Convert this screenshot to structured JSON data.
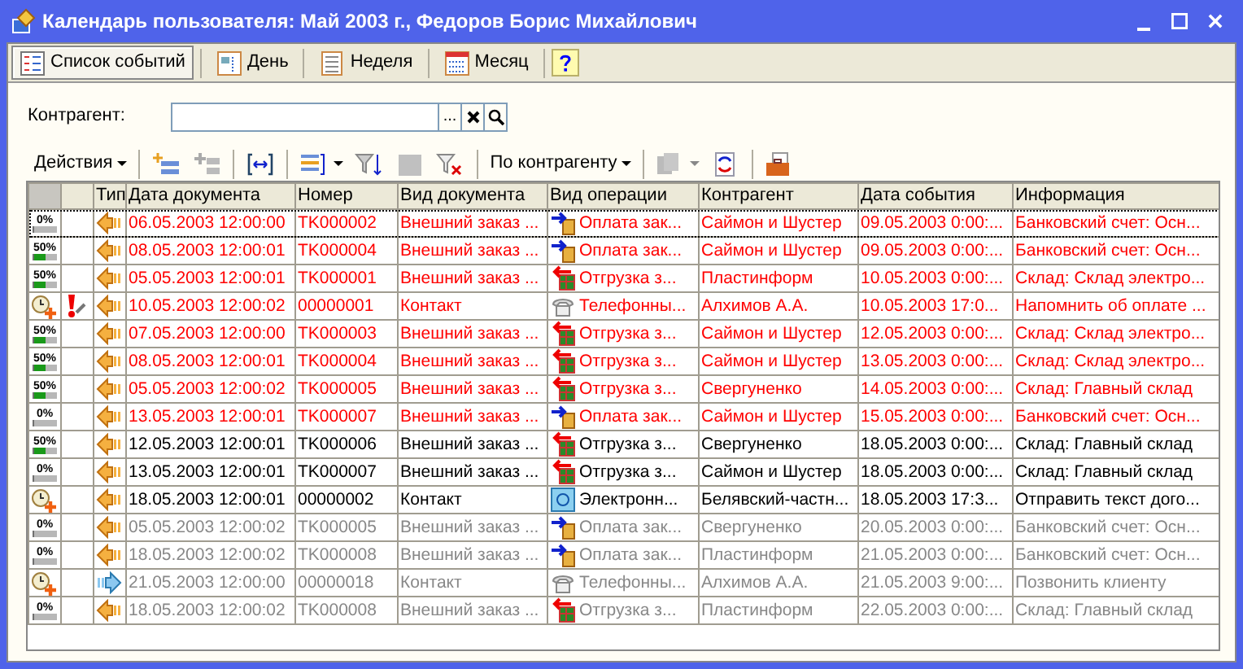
{
  "window": {
    "title": "Календарь пользователя: Май 2003 г., Федоров Борис Михайлович"
  },
  "view_tabs": [
    {
      "label": "Список событий",
      "kind": "list",
      "selected": true
    },
    {
      "label": "День",
      "kind": "day",
      "selected": false
    },
    {
      "label": "Неделя",
      "kind": "week",
      "selected": false
    },
    {
      "label": "Месяц",
      "kind": "month",
      "selected": false
    }
  ],
  "filter": {
    "label": "Контрагент:",
    "select_button": "..."
  },
  "actions_menu": "Действия",
  "group_menu": "По контрагенту",
  "table": {
    "columns": [
      "Тип",
      "Дата документа",
      "Номер",
      "Вид документа",
      "Вид операции",
      "Контрагент",
      "Дата события",
      "Информация"
    ],
    "rows": [
      {
        "selected": true,
        "overdue": true,
        "inactive": false,
        "status": {
          "kind": "task",
          "label": "0%",
          "level": 0
        },
        "important": false,
        "incoming": false,
        "doc_date": "06.05.2003 12:00:00",
        "number": "TK000002",
        "doc_type": "Внешний заказ ...",
        "operation": {
          "kind": "payment",
          "text": "Оплата зак..."
        },
        "counterparty": "Саймон и Шустер",
        "event_date": "09.05.2003 0:00:...",
        "info": "Банковский счет: Осн..."
      },
      {
        "selected": false,
        "overdue": true,
        "inactive": false,
        "status": {
          "kind": "task",
          "label": "50%",
          "level": 0.5
        },
        "important": false,
        "incoming": false,
        "doc_date": "08.05.2003 12:00:01",
        "number": "TK000004",
        "doc_type": "Внешний заказ ...",
        "operation": {
          "kind": "payment",
          "text": "Оплата зак..."
        },
        "counterparty": "Саймон и Шустер",
        "event_date": "09.05.2003 0:00:...",
        "info": "Банковский счет: Осн..."
      },
      {
        "selected": false,
        "overdue": true,
        "inactive": false,
        "status": {
          "kind": "task",
          "label": "50%",
          "level": 0.5
        },
        "important": false,
        "incoming": false,
        "doc_date": "05.05.2003 12:00:01",
        "number": "TK000001",
        "doc_type": "Внешний заказ ...",
        "operation": {
          "kind": "shipment",
          "text": "Отгрузка з..."
        },
        "counterparty": "Пластинформ",
        "event_date": "10.05.2003 0:00:...",
        "info": "Склад: Склад электро..."
      },
      {
        "selected": false,
        "overdue": true,
        "inactive": false,
        "status": {
          "kind": "contact"
        },
        "important": true,
        "incoming": false,
        "doc_date": "10.05.2003 12:00:02",
        "number": "00000001",
        "doc_type": "Контакт",
        "operation": {
          "kind": "phone",
          "text": "Телефонны..."
        },
        "counterparty": "Алхимов А.А.",
        "event_date": "10.05.2003 17:0...",
        "info": "Напомнить об оплате ..."
      },
      {
        "selected": false,
        "overdue": true,
        "inactive": false,
        "status": {
          "kind": "task",
          "label": "50%",
          "level": 0.5
        },
        "important": false,
        "incoming": false,
        "doc_date": "07.05.2003 12:00:00",
        "number": "TK000003",
        "doc_type": "Внешний заказ ...",
        "operation": {
          "kind": "shipment",
          "text": "Отгрузка з..."
        },
        "counterparty": "Саймон и Шустер",
        "event_date": "12.05.2003 0:00:...",
        "info": "Склад: Склад электро..."
      },
      {
        "selected": false,
        "overdue": true,
        "inactive": false,
        "status": {
          "kind": "task",
          "label": "50%",
          "level": 0.5
        },
        "important": false,
        "incoming": false,
        "doc_date": "08.05.2003 12:00:01",
        "number": "TK000004",
        "doc_type": "Внешний заказ ...",
        "operation": {
          "kind": "shipment",
          "text": "Отгрузка з..."
        },
        "counterparty": "Саймон и Шустер",
        "event_date": "13.05.2003 0:00:...",
        "info": "Склад: Склад электро..."
      },
      {
        "selected": false,
        "overdue": true,
        "inactive": false,
        "status": {
          "kind": "task",
          "label": "50%",
          "level": 0.5
        },
        "important": false,
        "incoming": false,
        "doc_date": "05.05.2003 12:00:02",
        "number": "TK000005",
        "doc_type": "Внешний заказ ...",
        "operation": {
          "kind": "shipment",
          "text": "Отгрузка з..."
        },
        "counterparty": "Свергуненко",
        "event_date": "14.05.2003 0:00:...",
        "info": "Склад: Главный склад"
      },
      {
        "selected": false,
        "overdue": true,
        "inactive": false,
        "status": {
          "kind": "task",
          "label": "0%",
          "level": 0
        },
        "important": false,
        "incoming": false,
        "doc_date": "13.05.2003 12:00:01",
        "number": "TK000007",
        "doc_type": "Внешний заказ ...",
        "operation": {
          "kind": "payment",
          "text": "Оплата зак..."
        },
        "counterparty": "Саймон и Шустер",
        "event_date": "15.05.2003 0:00:...",
        "info": "Банковский счет: Осн..."
      },
      {
        "selected": false,
        "overdue": false,
        "inactive": false,
        "status": {
          "kind": "task",
          "label": "50%",
          "level": 0.5
        },
        "important": false,
        "incoming": false,
        "doc_date": "12.05.2003 12:00:01",
        "number": "TK000006",
        "doc_type": "Внешний заказ ...",
        "operation": {
          "kind": "shipment",
          "text": "Отгрузка з..."
        },
        "counterparty": "Свергуненко",
        "event_date": "18.05.2003 0:00:...",
        "info": "Склад: Главный склад"
      },
      {
        "selected": false,
        "overdue": false,
        "inactive": false,
        "status": {
          "kind": "task",
          "label": "0%",
          "level": 0
        },
        "important": false,
        "incoming": false,
        "doc_date": "13.05.2003 12:00:01",
        "number": "TK000007",
        "doc_type": "Внешний заказ ...",
        "operation": {
          "kind": "shipment",
          "text": "Отгрузка з..."
        },
        "counterparty": "Саймон и Шустер",
        "event_date": "18.05.2003 0:00:...",
        "info": "Склад: Главный склад"
      },
      {
        "selected": false,
        "overdue": false,
        "inactive": false,
        "status": {
          "kind": "contact"
        },
        "important": false,
        "incoming": false,
        "doc_date": "18.05.2003 12:00:01",
        "number": "00000002",
        "doc_type": "Контакт",
        "operation": {
          "kind": "email",
          "text": "Электронн..."
        },
        "counterparty": "Белявский-частн...",
        "event_date": "18.05.2003 17:3...",
        "info": "Отправить текст дого..."
      },
      {
        "selected": false,
        "overdue": false,
        "inactive": true,
        "status": {
          "kind": "task",
          "label": "0%",
          "level": 0
        },
        "important": false,
        "incoming": false,
        "doc_date": "05.05.2003 12:00:02",
        "number": "TK000005",
        "doc_type": "Внешний заказ ...",
        "operation": {
          "kind": "payment",
          "text": "Оплата зак..."
        },
        "counterparty": "Свергуненко",
        "event_date": "20.05.2003 0:00:...",
        "info": "Банковский счет: Осн..."
      },
      {
        "selected": false,
        "overdue": false,
        "inactive": true,
        "status": {
          "kind": "task",
          "label": "0%",
          "level": 0
        },
        "important": false,
        "incoming": false,
        "doc_date": "18.05.2003 12:00:02",
        "number": "TK000008",
        "doc_type": "Внешний заказ ...",
        "operation": {
          "kind": "payment",
          "text": "Оплата зак..."
        },
        "counterparty": "Пластинформ",
        "event_date": "21.05.2003 0:00:...",
        "info": "Банковский счет: Осн..."
      },
      {
        "selected": false,
        "overdue": false,
        "inactive": true,
        "status": {
          "kind": "contact"
        },
        "important": false,
        "incoming": true,
        "doc_date": "21.05.2003 12:00:00",
        "number": "00000018",
        "doc_type": "Контакт",
        "operation": {
          "kind": "phone",
          "text": "Телефонны..."
        },
        "counterparty": "Алхимов А.А.",
        "event_date": "21.05.2003 9:00:...",
        "info": "Позвонить клиенту"
      },
      {
        "selected": false,
        "overdue": false,
        "inactive": true,
        "status": {
          "kind": "task",
          "label": "0%",
          "level": 0
        },
        "important": false,
        "incoming": false,
        "doc_date": "18.05.2003 12:00:02",
        "number": "TK000008",
        "doc_type": "Внешний заказ ...",
        "operation": {
          "kind": "shipment",
          "text": "Отгрузка з..."
        },
        "counterparty": "Пластинформ",
        "event_date": "22.05.2003 0:00:...",
        "info": "Склад: Главный склад"
      }
    ]
  }
}
